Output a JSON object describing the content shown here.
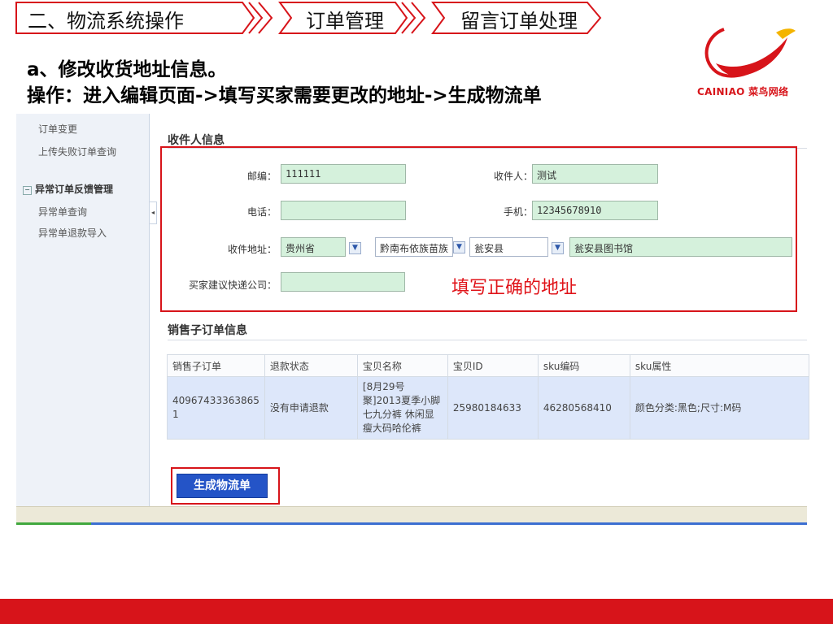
{
  "breadcrumb": {
    "items": [
      "二、物流系统操作",
      "订单管理",
      "留言订单处理"
    ]
  },
  "instructions": {
    "title": "a、修改收货地址信息。",
    "steps": "操作：进入编辑页面->填写买家需要更改的地址->生成物流单"
  },
  "logo": {
    "text": "CAINIAO 菜鸟网络"
  },
  "sidebar": {
    "items": [
      "订单变更",
      "上传失败订单查询"
    ],
    "group": {
      "label": "异常订单反馈管理",
      "items": [
        "异常单查询",
        "异常单退款导入"
      ]
    }
  },
  "recipient": {
    "section_title": "收件人信息",
    "postcode_label": "邮编：",
    "postcode": "111111",
    "name_label": "收件人：",
    "name": "测试",
    "phone_label": "电话：",
    "phone": "",
    "mobile_label": "手机：",
    "mobile": "12345678910",
    "address_label": "收件地址：",
    "province": "贵州省",
    "city": "黔南布依族苗族",
    "county": "瓮安县",
    "detail_address": "瓮安县图书馆",
    "courier_label": "买家建议快递公司：",
    "courier": ""
  },
  "annotation": "填写正确的地址",
  "suborders": {
    "section_title": "销售子订单信息",
    "columns": [
      "销售子订单",
      "退款状态",
      "宝贝名称",
      "宝贝ID",
      "sku编码",
      "sku属性"
    ],
    "rows": [
      {
        "order_id": "40967433363865 1",
        "refund_status": "没有申请退款",
        "item_name": "[8月29号聚]2013夏季小脚七九分裤 休闲显瘦大码哈伦裤",
        "item_id": "25980184633",
        "sku_code": "46280568410",
        "sku_attr": "颜色分类:黑色;尺寸:M码"
      }
    ]
  },
  "actions": {
    "generate_label": "生成物流单"
  },
  "colors": {
    "accent_red": "#d7141a",
    "input_green": "#d5f1dc",
    "button_blue": "#2454c7"
  }
}
